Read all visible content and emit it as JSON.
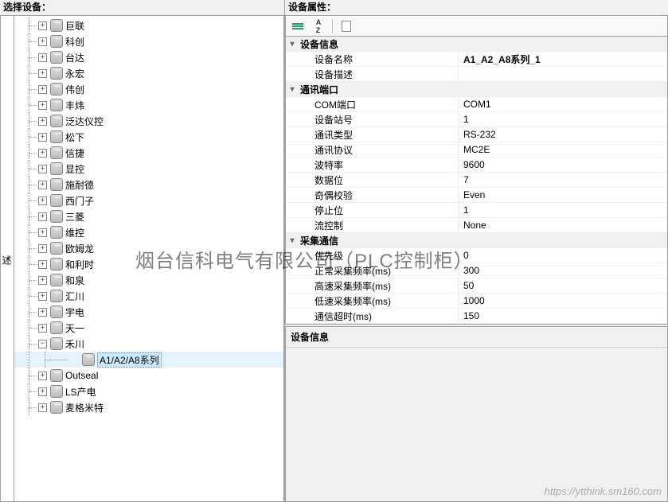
{
  "left": {
    "title": "选择设备：",
    "side_tab": "述",
    "tree": [
      {
        "label": "巨联",
        "expandable": true
      },
      {
        "label": "科创",
        "expandable": true
      },
      {
        "label": "台达",
        "expandable": true
      },
      {
        "label": "永宏",
        "expandable": true
      },
      {
        "label": "伟创",
        "expandable": true
      },
      {
        "label": "丰炜",
        "expandable": true
      },
      {
        "label": "泛达仪控",
        "expandable": true
      },
      {
        "label": "松下",
        "expandable": true
      },
      {
        "label": "信捷",
        "expandable": true
      },
      {
        "label": "显控",
        "expandable": true
      },
      {
        "label": "施耐德",
        "expandable": true
      },
      {
        "label": "西门子",
        "expandable": true
      },
      {
        "label": "三菱",
        "expandable": true
      },
      {
        "label": "维控",
        "expandable": true
      },
      {
        "label": "欧姆龙",
        "expandable": true
      },
      {
        "label": "和利时",
        "expandable": true
      },
      {
        "label": "和泉",
        "expandable": true
      },
      {
        "label": "汇川",
        "expandable": true
      },
      {
        "label": "宇电",
        "expandable": true
      },
      {
        "label": "天一",
        "expandable": true
      },
      {
        "label": "禾川",
        "expandable": true,
        "expanded": true,
        "children": [
          {
            "label": "A1/A2/A8系列",
            "selected": true
          }
        ]
      },
      {
        "label": "Outseal",
        "expandable": true
      },
      {
        "label": "LS产电",
        "expandable": true
      },
      {
        "label": "麦格米特",
        "expandable": true
      }
    ]
  },
  "right": {
    "title": "设备属性：",
    "toolbar": {
      "categorize_tip": "按分类排序",
      "alpha_tip": "按字母排序",
      "pages_tip": "属性页"
    },
    "groups": [
      {
        "name": "设备信息",
        "items": [
          {
            "key": "设备名称",
            "val": "A1_A2_A8系列_1",
            "bold": true
          },
          {
            "key": "设备描述",
            "val": ""
          }
        ]
      },
      {
        "name": "通讯端口",
        "items": [
          {
            "key": "COM端口",
            "val": "COM1"
          },
          {
            "key": "设备站号",
            "val": "1"
          },
          {
            "key": "通讯类型",
            "val": "RS-232"
          },
          {
            "key": "通讯协议",
            "val": "MC2E"
          },
          {
            "key": "波特率",
            "val": "9600"
          },
          {
            "key": "数据位",
            "val": "7"
          },
          {
            "key": "奇偶校验",
            "val": "Even"
          },
          {
            "key": "停止位",
            "val": "1"
          },
          {
            "key": "流控制",
            "val": "None"
          }
        ]
      },
      {
        "name": "采集通信",
        "items": [
          {
            "key": "优先级",
            "val": "0"
          },
          {
            "key": "正常采集频率(ms)",
            "val": "300"
          },
          {
            "key": "高速采集频率(ms)",
            "val": "50"
          },
          {
            "key": "低速采集频率(ms)",
            "val": "1000"
          },
          {
            "key": "通信超时(ms)",
            "val": "150"
          }
        ]
      }
    ],
    "info_panel_title": "设备信息"
  },
  "watermark": "烟台信科电气有限公司（PLC控制柜）",
  "watermark_url": "https://ytthink.sm160.com"
}
